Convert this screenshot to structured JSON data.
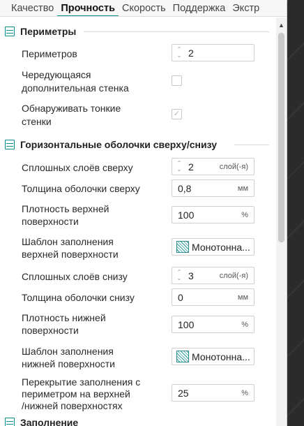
{
  "tabs": [
    {
      "label": "Качество"
    },
    {
      "label": "Прочность"
    },
    {
      "label": "Скорость"
    },
    {
      "label": "Поддержка"
    },
    {
      "label": "Экстр"
    }
  ],
  "active_tab": "Прочность",
  "accent_color": "#0a8c8c",
  "sections": {
    "perimeters": {
      "title": "Периметры",
      "icon": "perimeters-icon",
      "perimeters_count": {
        "label": "Периметров",
        "value": "2"
      },
      "alt_extra_wall": {
        "label_1": "Чередующаяся",
        "label_2": "дополнительная стенка",
        "checked": false
      },
      "detect_thin_wall": {
        "label_1": "Обнаруживать тонкие",
        "label_2": "стенки",
        "checked": true,
        "disabled": true
      }
    },
    "shells": {
      "title": "Горизонтальные оболочки сверху/снизу",
      "icon": "shells-icon",
      "top_layers": {
        "label": "Сплошных слоёв сверху",
        "value": "2",
        "unit": "слой(-я)"
      },
      "top_thickness": {
        "label": "Толщина оболочки сверху",
        "value": "0,8",
        "unit": "мм"
      },
      "top_density": {
        "label_1": "Плотность верхней",
        "label_2": "поверхности",
        "value": "100",
        "unit": "%"
      },
      "top_pattern": {
        "label_1": "Шаблон заполнения",
        "label_2": "верхней поверхности",
        "value": "Монотонна..."
      },
      "bottom_layers": {
        "label": "Сплошных слоёв снизу",
        "value": "3",
        "unit": "слой(-я)"
      },
      "bottom_thickness": {
        "label": "Толщина оболочки снизу",
        "value": "0",
        "unit": "мм"
      },
      "bottom_density": {
        "label_1": "Плотность нижней",
        "label_2": "поверхности",
        "value": "100",
        "unit": "%"
      },
      "bottom_pattern": {
        "label_1": "Шаблон заполнения",
        "label_2": "нижней поверхности",
        "value": "Монотонна..."
      },
      "infill_overlap": {
        "label_1": "Перекрытие заполнения с",
        "label_2": "периметром на верхней",
        "label_3": "/нижней поверхностях",
        "value": "25",
        "unit": "%"
      }
    },
    "infill": {
      "title": "Заполнение",
      "icon": "infill-icon"
    }
  }
}
